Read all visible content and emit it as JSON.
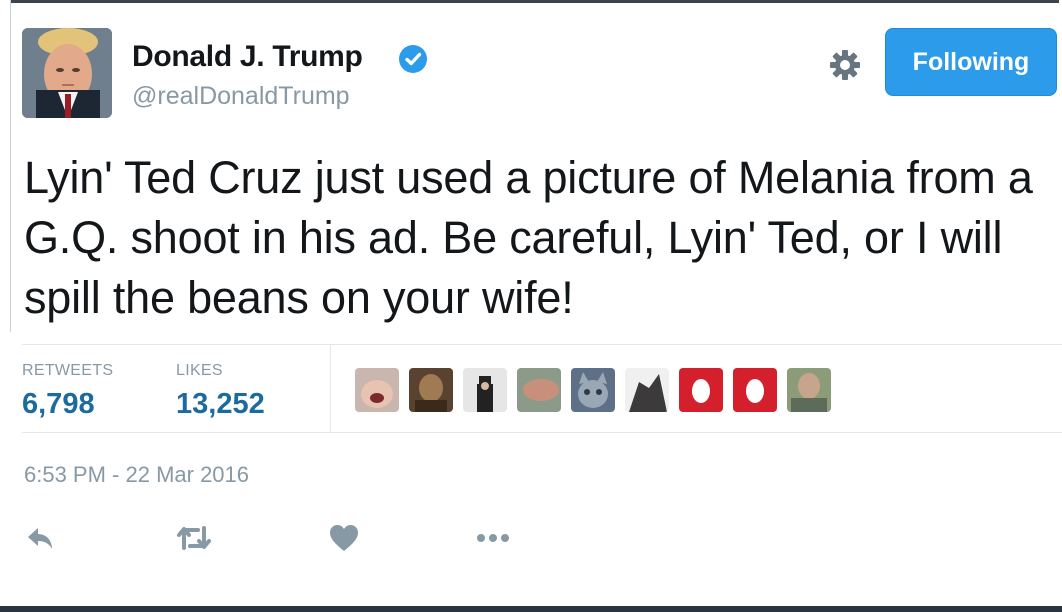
{
  "user": {
    "name": "Donald J. Trump",
    "handle": "@realDonaldTrump",
    "verified": true
  },
  "follow_button": {
    "label": "Following",
    "color": "#2b9bea"
  },
  "tweet": {
    "text": "Lyin' Ted Cruz just used a picture of Melania from a G.Q. shoot in his ad. Be careful, Lyin' Ted, or I will spill the beans on your wife!"
  },
  "stats": {
    "retweets_label": "RETWEETS",
    "retweets_value": "6,798",
    "likes_label": "LIKES",
    "likes_value": "13,252"
  },
  "likers": [
    {
      "icon": "avatar-face-1"
    },
    {
      "icon": "avatar-portrait-2"
    },
    {
      "icon": "avatar-figure-3"
    },
    {
      "icon": "avatar-arm-4"
    },
    {
      "icon": "avatar-cat-5"
    },
    {
      "icon": "avatar-dark-6"
    },
    {
      "icon": "default-egg-avatar"
    },
    {
      "icon": "default-egg-avatar"
    },
    {
      "icon": "avatar-face-9"
    }
  ],
  "timestamp": "6:53 PM - 22 Mar 2016",
  "actions": [
    {
      "icon": "reply-icon"
    },
    {
      "icon": "retweet-icon"
    },
    {
      "icon": "like-heart-icon"
    },
    {
      "icon": "more-dots-icon"
    }
  ]
}
